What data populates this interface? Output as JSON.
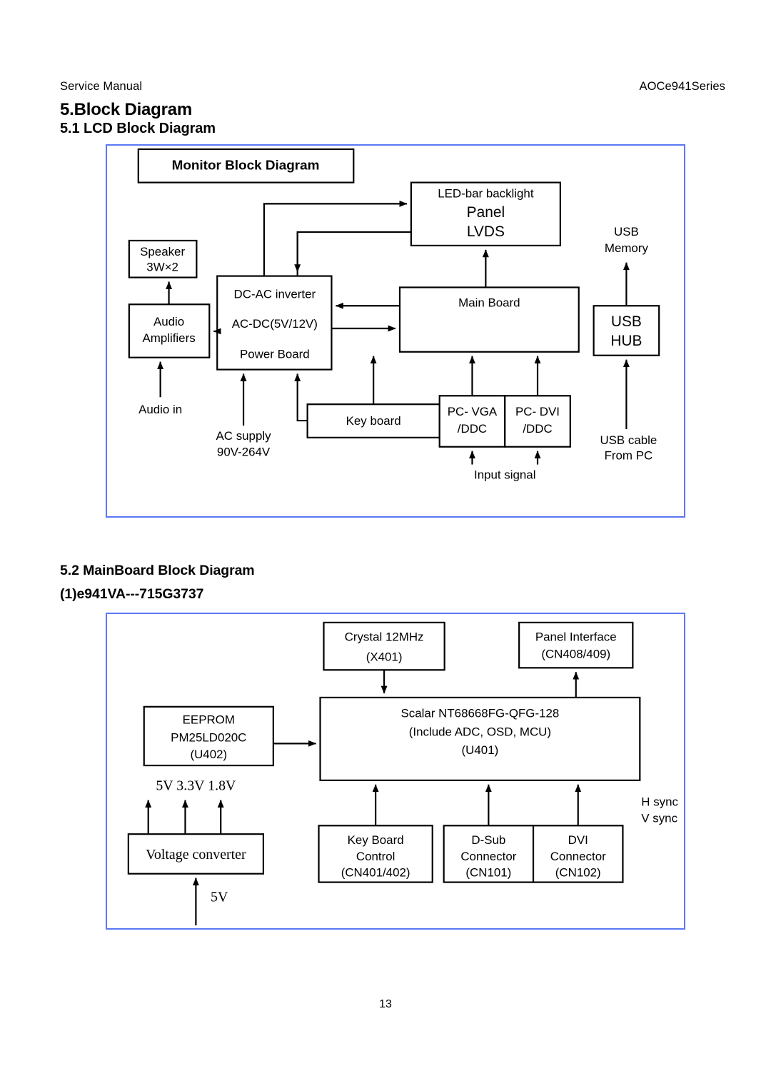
{
  "header": {
    "left": "Service Manual",
    "right": "AOCe941Series"
  },
  "headings": {
    "section": "5.Block Diagram",
    "sub1": "5.1 LCD Block Diagram",
    "sub2": "5.2 MainBoard Block Diagram",
    "sub2_model": "(1)e941VA---715G3737"
  },
  "footer": {
    "page_number": "13"
  },
  "colors": {
    "frame_border": "#5c78f4",
    "box_stroke": "#000000",
    "text": "#000000",
    "background": "#ffffff"
  },
  "lcd_diagram": {
    "title": "Monitor Block Diagram",
    "blocks": {
      "panel": {
        "line1": "LED-bar backlight",
        "line2": "Panel",
        "line3": "LVDS"
      },
      "speaker": {
        "line1": "Speaker",
        "line2": "3W×2"
      },
      "audio_amplifiers": {
        "line1": "Audio",
        "line2": "Amplifiers"
      },
      "power_board": {
        "line1": "DC-AC inverter",
        "line2": "AC-DC(5V/12V)",
        "line3": "Power Board"
      },
      "main_board": {
        "line1": "Main Board"
      },
      "key_board": {
        "line1": "Key board"
      },
      "pc_vga": {
        "line1": "PC- VGA",
        "line2": "/DDC"
      },
      "pc_dvi": {
        "line1": "PC- DVI",
        "line2": "/DDC"
      },
      "usb_hub": {
        "line1": "USB",
        "line2": "HUB"
      }
    },
    "labels": {
      "usb_memory_l1": "USB",
      "usb_memory_l2": "Memory",
      "audio_in": "Audio in",
      "ac_supply_l1": "AC supply",
      "ac_supply_l2": "90V-264V",
      "input_signal": "Input signal",
      "usb_cable_l1": "USB cable",
      "usb_cable_l2": "From PC"
    }
  },
  "mainboard_diagram": {
    "blocks": {
      "crystal": {
        "line1": "Crystal 12MHz",
        "line2": "(X401)"
      },
      "panel_interface": {
        "line1": "Panel Interface",
        "line2": "(CN408/409)"
      },
      "eeprom": {
        "line1": "EEPROM",
        "line2": "PM25LD020C",
        "line3": "(U402)"
      },
      "scalar": {
        "line1": "Scalar NT68668FG-QFG-128",
        "line2": "(Include ADC, OSD, MCU)",
        "line3": "(U401)"
      },
      "voltage_converter": {
        "line1": "Voltage converter"
      },
      "key_board_control": {
        "line1": "Key Board",
        "line2": "Control",
        "line3": "(CN401/402)"
      },
      "dsub_connector": {
        "line1": "D-Sub",
        "line2": "Connector",
        "line3": "(CN101)"
      },
      "dvi_connector": {
        "line1": "DVI",
        "line2": "Connector",
        "line3": "(CN102)"
      }
    },
    "labels": {
      "rails": "5V 3.3V 1.8V",
      "input_5v": "5V",
      "hsync": "H sync",
      "vsync": "V sync"
    }
  }
}
